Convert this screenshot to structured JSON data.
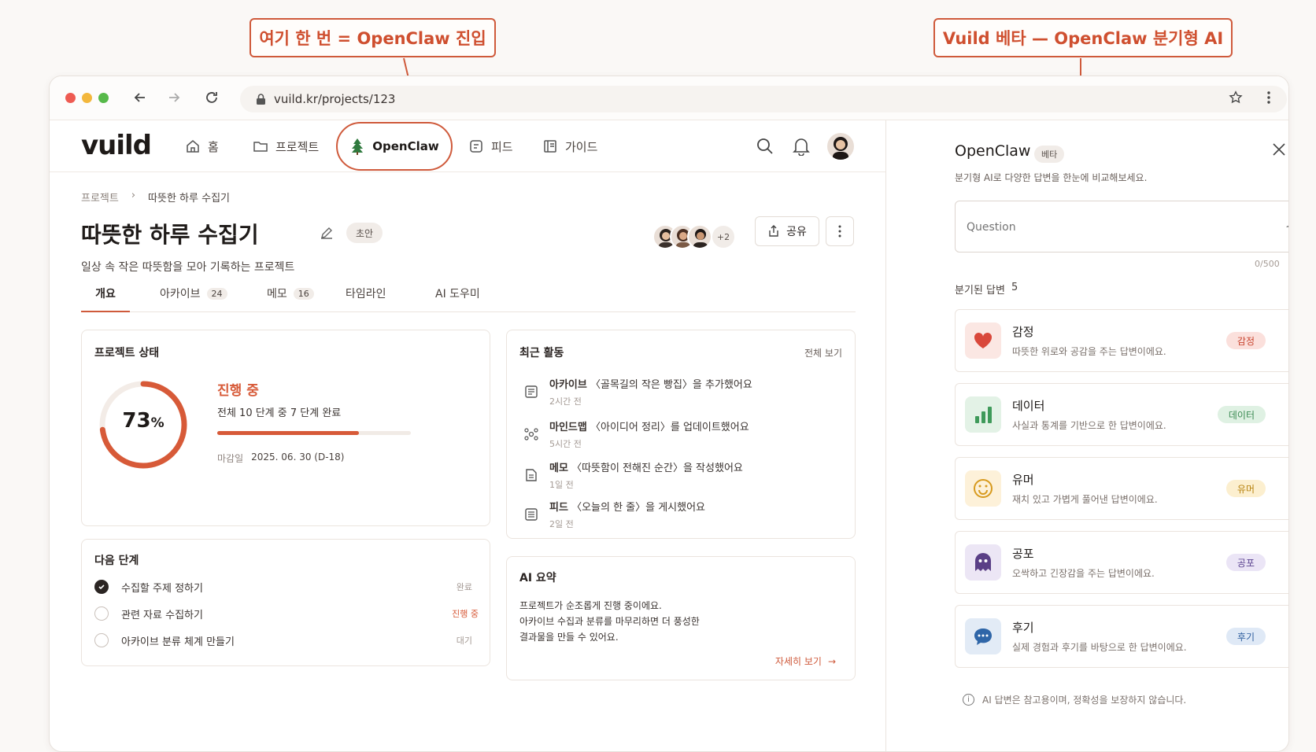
{
  "callouts": {
    "left": "여기 한 번 = OpenClaw 진입",
    "right": "Vuild 베타 — OpenClaw 분기형 AI"
  },
  "browser": {
    "url": "vuild.kr/projects/123"
  },
  "nav": {
    "logo": "vuild",
    "items": [
      {
        "label": "홈",
        "icon": "home-icon"
      },
      {
        "label": "프로젝트",
        "icon": "folder-icon"
      },
      {
        "label": "OpenClaw",
        "icon": "tree-icon"
      },
      {
        "label": "피드",
        "icon": "feed-icon"
      },
      {
        "label": "가이드",
        "icon": "book-icon"
      }
    ]
  },
  "breadcrumb": {
    "root": "프로젝트",
    "current": "따뜻한 하루 수집기"
  },
  "project": {
    "title": "따뜻한 하루 수집기",
    "status_badge": "초안",
    "description": "일상 속 작은 따뜻함을 모아 기록하는 프로젝트",
    "extra_members": "+2",
    "share_label": "공유"
  },
  "tabs": [
    {
      "label": "개요",
      "count": ""
    },
    {
      "label": "아카이브",
      "count": "24"
    },
    {
      "label": "메모",
      "count": "16"
    },
    {
      "label": "타임라인",
      "count": ""
    },
    {
      "label": "AI 도우미",
      "count": ""
    }
  ],
  "status_card": {
    "title": "프로젝트 상태",
    "percent_num": "73",
    "percent_sign": "%",
    "progress": 0.73,
    "state": "진행 중",
    "steps": "전체 10 단계 중 7 단계 완료",
    "deadline_label": "마감일",
    "deadline": "2025. 06. 30 (D-18)"
  },
  "activity": {
    "title": "최근 활동",
    "view_all": "전체 보기",
    "items": [
      {
        "type": "아카이브",
        "text": "〈골목길의 작은 빵집〉을 추가했어요",
        "time": "2시간 전",
        "icon": "archive-icon"
      },
      {
        "type": "마인드맵",
        "text": "〈아이디어 정리〉를 업데이트했어요",
        "time": "5시간 전",
        "icon": "mindmap-icon"
      },
      {
        "type": "메모",
        "text": "〈따뜻함이 전해진 순간〉을 작성했어요",
        "time": "1일 전",
        "icon": "memo-icon"
      },
      {
        "type": "피드",
        "text": "〈오늘의 한 줄〉을 게시했어요",
        "time": "2일 전",
        "icon": "feed-icon"
      }
    ]
  },
  "next_steps": {
    "title": "다음 단계",
    "items": [
      {
        "label": "수집할 주제 정하기",
        "state": "완료"
      },
      {
        "label": "관련 자료 수집하기",
        "state": "진행 중"
      },
      {
        "label": "아카이브 분류 체계 만들기",
        "state": "대기"
      }
    ]
  },
  "ai_summary": {
    "title": "AI 요약",
    "lines": [
      "프로젝트가 순조롭게 진행 중이에요.",
      "아카이브 수집과 분류를 마무리하면 더 풍성한",
      "결과물을 만들 수 있어요."
    ],
    "link": "자세히 보기"
  },
  "openclaw": {
    "title": "OpenClaw",
    "beta": "베타",
    "subtitle": "분기형 AI로 다양한 답변을 한눈에 비교해보세요.",
    "placeholder": "Question",
    "counter": "0/500",
    "branches_label": "분기된 답변",
    "branches_count": "5",
    "branches": [
      {
        "name": "감정",
        "desc": "따뜻한 위로와 공감을 주는 답변이에요.",
        "tag": "감정",
        "color": "#d9483b",
        "bg": "#fbe7e3",
        "tagbg": "#fbe0dc",
        "tagfg": "#c8442f"
      },
      {
        "name": "데이터",
        "desc": "사실과 통계를 기반으로 한 답변이에요.",
        "tag": "데이터",
        "color": "#3f9a5a",
        "bg": "#e3f2e6",
        "tagbg": "#dff1e3",
        "tagfg": "#3a8a52"
      },
      {
        "name": "유머",
        "desc": "재치 있고 가볍게 풀어낸 답변이에요.",
        "tag": "유머",
        "color": "#d79a1e",
        "bg": "#fdf1d9",
        "tagbg": "#fcefcf",
        "tagfg": "#b7830f"
      },
      {
        "name": "공포",
        "desc": "오싹하고 긴장감을 주는 답변이에요.",
        "tag": "공포",
        "color": "#5a3f86",
        "bg": "#ece6f5",
        "tagbg": "#ebe5f6",
        "tagfg": "#5b4390"
      },
      {
        "name": "후기",
        "desc": "실제 경험과 후기를 바탕으로 한 답변이에요.",
        "tag": "후기",
        "color": "#2f66a8",
        "bg": "#e2ebf6",
        "tagbg": "#dfe9f6",
        "tagfg": "#2f5f9f"
      }
    ],
    "disclaimer": "AI 답변은 참고용이며, 정확성을 보장하지 않습니다."
  }
}
